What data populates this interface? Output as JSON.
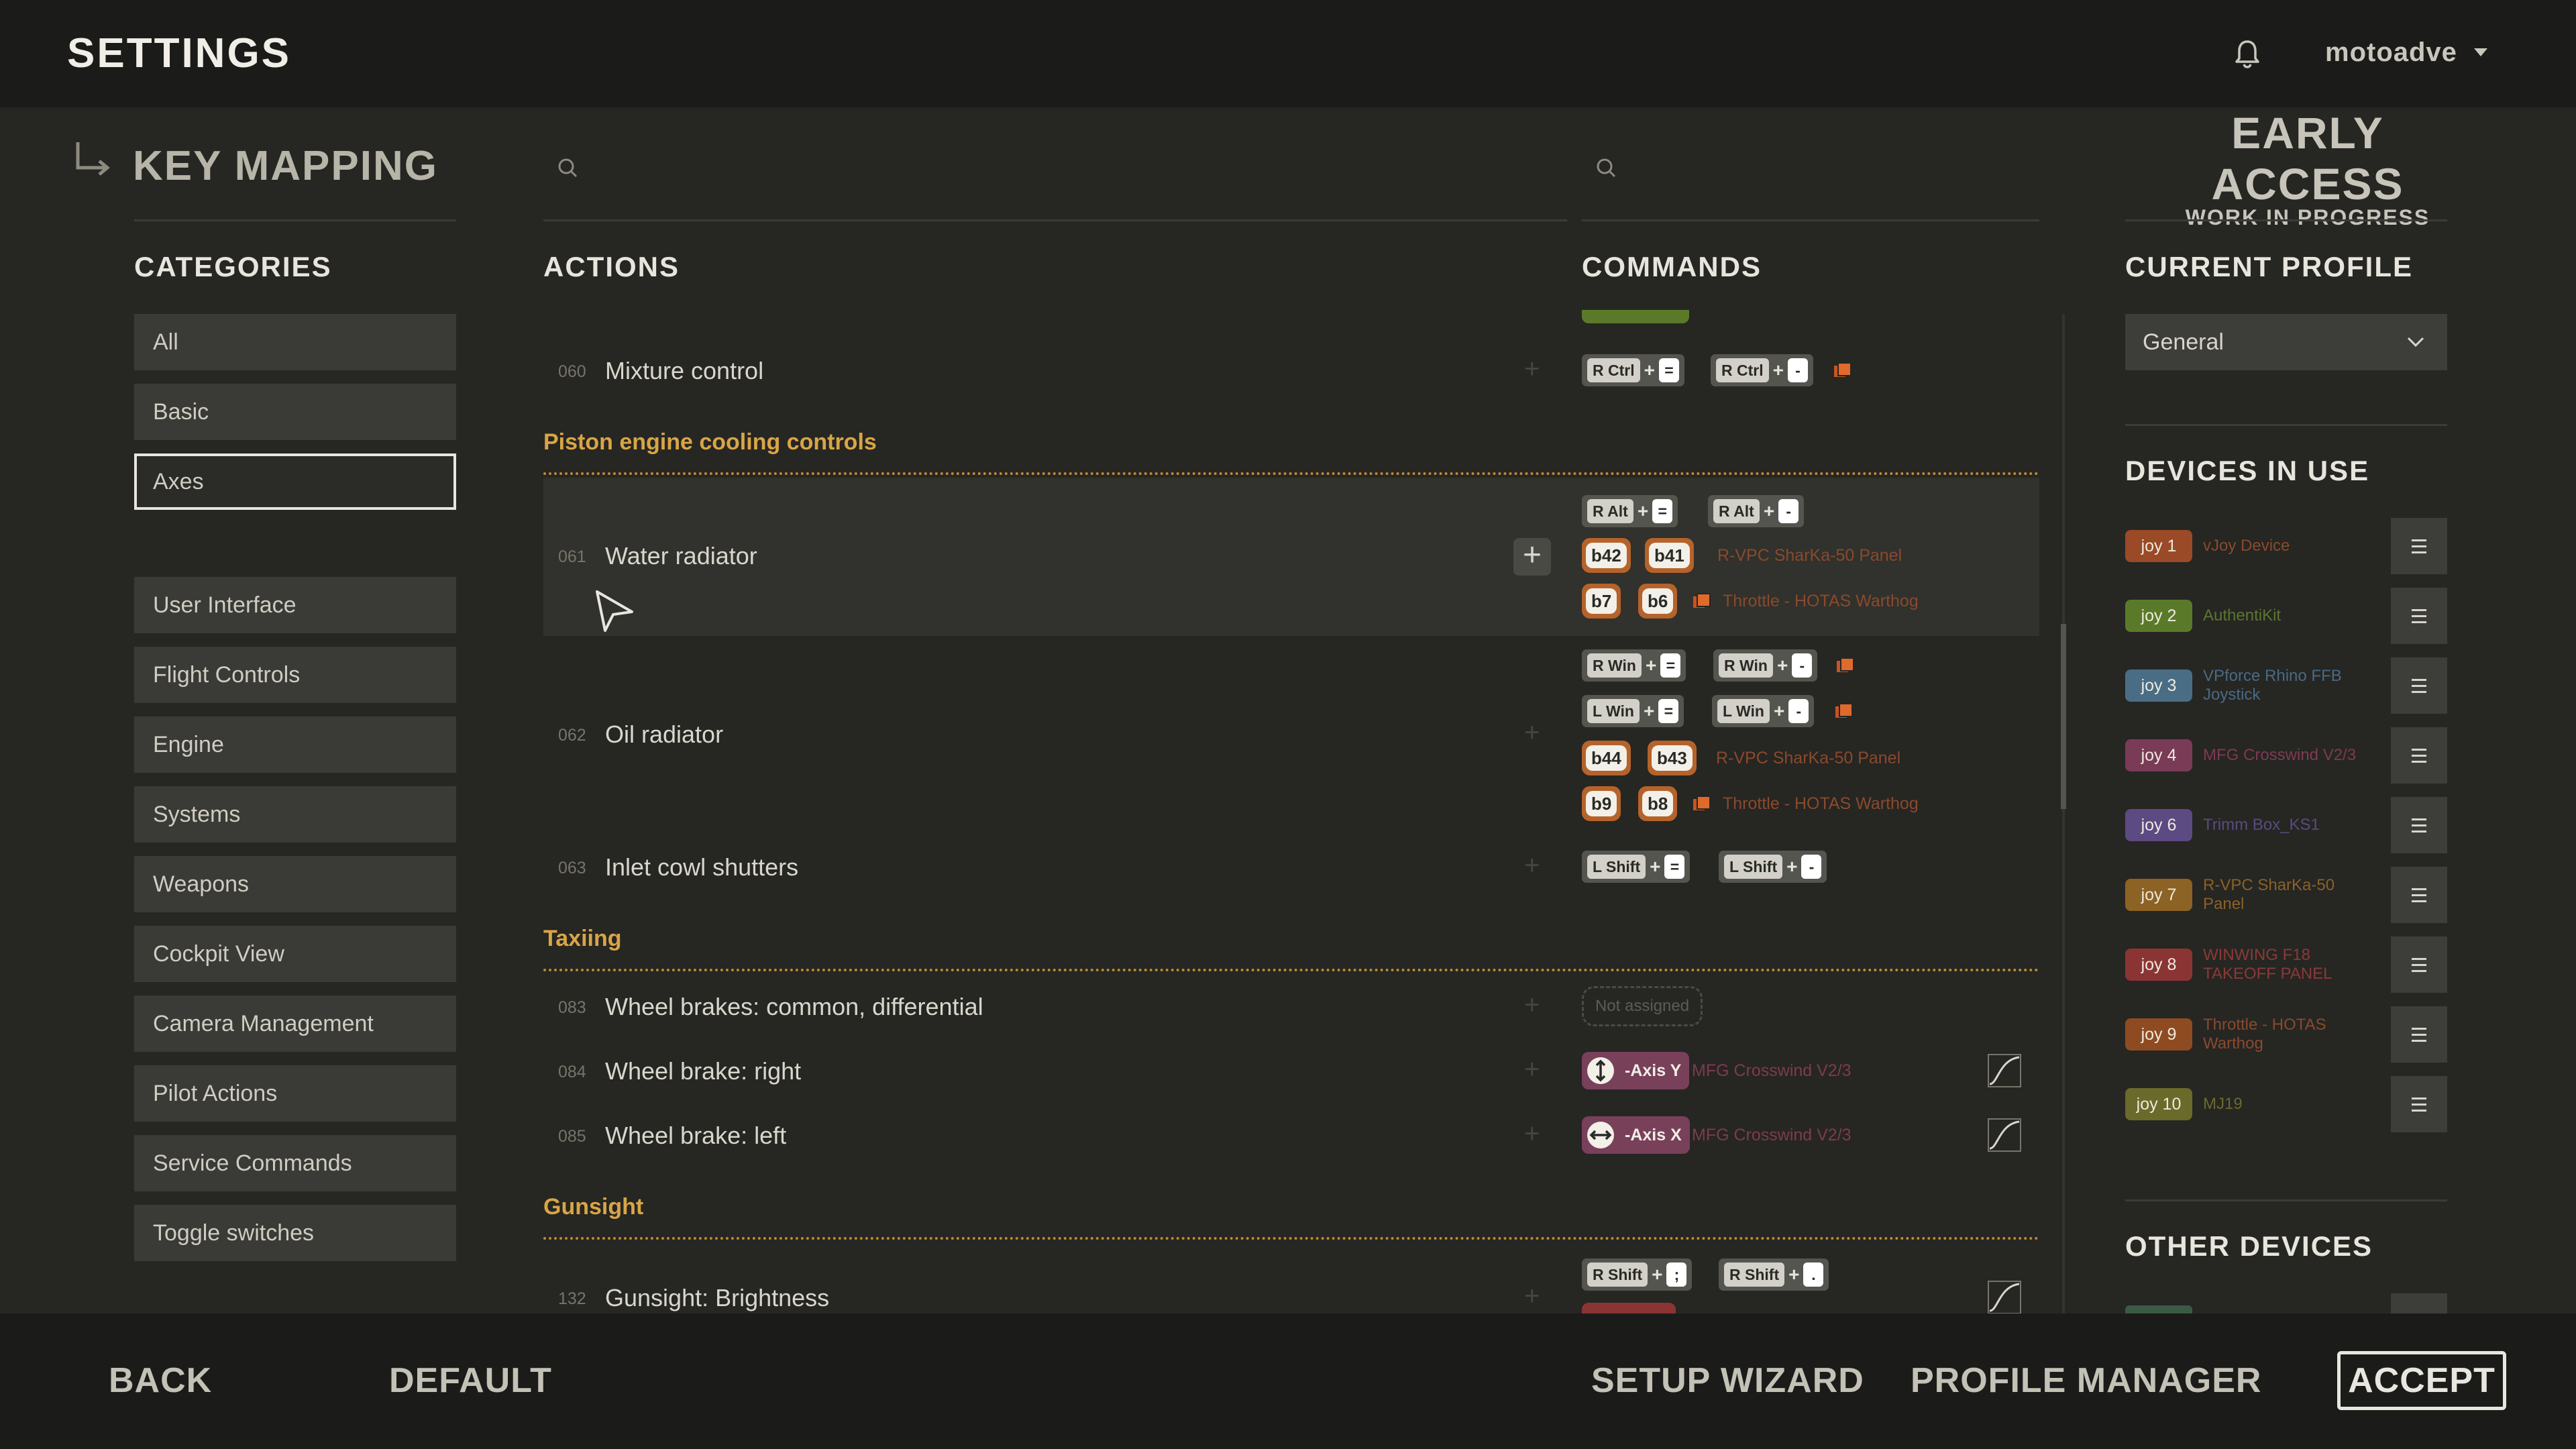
{
  "header": {
    "title": "SETTINGS",
    "username": "motoadve"
  },
  "page": {
    "title": "KEY MAPPING",
    "early_access": "EARLY ACCESS",
    "work_in_progress": "WORK IN PROGRESS"
  },
  "sections": {
    "categories": "CATEGORIES",
    "actions": "ACTIONS",
    "commands": "COMMANDS",
    "current_profile": "CURRENT PROFILE",
    "devices_in_use": "DEVICES IN USE",
    "other_devices": "OTHER DEVICES"
  },
  "categories": [
    "All",
    "Basic",
    "Axes",
    "User Interface",
    "Flight Controls",
    "Engine",
    "Systems",
    "Weapons",
    "Cockpit View",
    "Camera Management",
    "Pilot Actions",
    "Service Commands",
    "Toggle switches"
  ],
  "selected_category": "Axes",
  "actions": {
    "headers": {
      "cooling": "Piston engine cooling controls",
      "taxiing": "Taxiing",
      "gunsight": "Gunsight"
    },
    "rows": [
      {
        "num": "060",
        "name": "Mixture control"
      },
      {
        "num": "061",
        "name": "Water radiator"
      },
      {
        "num": "062",
        "name": "Oil radiator"
      },
      {
        "num": "063",
        "name": "Inlet cowl shutters"
      },
      {
        "num": "083",
        "name": "Wheel brakes: common, differential"
      },
      {
        "num": "084",
        "name": "Wheel brake: right"
      },
      {
        "num": "085",
        "name": "Wheel brake: left"
      },
      {
        "num": "132",
        "name": "Gunsight: Brightness"
      }
    ]
  },
  "commands": {
    "keys": {
      "rctrl": "R Ctrl",
      "ralt": "R Alt",
      "rwin": "R Win",
      "lwin": "L Win",
      "lshift": "L Shift",
      "rshift": "R Shift",
      "eq": "=",
      "minus": "-",
      "semicolon": ";",
      "period": ".",
      "plus": "+"
    },
    "buttons": {
      "b42": "b42",
      "b41": "b41",
      "b7": "b7",
      "b6": "b6",
      "b44": "b44",
      "b43": "b43",
      "b9": "b9",
      "b8": "b8"
    },
    "devices": {
      "sharka": "R-VPC SharKa-50 Panel",
      "throttle": "Throttle - HOTAS Warthog",
      "crosswind": "MFG Crosswind V2/3"
    },
    "not_assigned": "Not assigned",
    "axis_y": "-Axis Y",
    "axis_x": "-Axis X"
  },
  "profile": {
    "selected": "General"
  },
  "devices_in_use": [
    {
      "joy": "joy 1",
      "name": "vJoy Device",
      "color": "#9a4a26",
      "text_color": "#8a4a2c"
    },
    {
      "joy": "joy 2",
      "name": "AuthentiKit",
      "color": "#5a7a2a",
      "text_color": "#5c7530"
    },
    {
      "joy": "joy 3",
      "name": "VPforce Rhino FFB Joystick",
      "color": "#4a6d86",
      "text_color": "#4a6a84"
    },
    {
      "joy": "joy 4",
      "name": "MFG Crosswind V2/3",
      "color": "#7a3b56",
      "text_color": "#7f3a52"
    },
    {
      "joy": "joy 6",
      "name": "Trimm Box_KS1",
      "color": "#5c4a82",
      "text_color": "#5b4a80"
    },
    {
      "joy": "joy 7",
      "name": "R-VPC SharKa-50 Panel",
      "color": "#8c6225",
      "text_color": "#8a6226"
    },
    {
      "joy": "joy 8",
      "name": "WINWING F18 TAKEOFF PANEL",
      "color": "#8a3534",
      "text_color": "#8a3a38"
    },
    {
      "joy": "joy 9",
      "name": "Throttle - HOTAS Warthog",
      "color": "#8e4b22",
      "text_color": "#8a4a2c"
    },
    {
      "joy": "joy 10",
      "name": "MJ19",
      "color": "#6a6a2a",
      "text_color": "#6a6a30"
    }
  ],
  "footer": {
    "back": "BACK",
    "default": "DEFAULT",
    "setup_wizard": "SETUP WIZARD",
    "profile_manager": "PROFILE MANAGER",
    "accept": "ACCEPT"
  },
  "colors": {
    "accent_orange": "#d9a545",
    "background": "#262623",
    "bar": "#1b1b19"
  }
}
